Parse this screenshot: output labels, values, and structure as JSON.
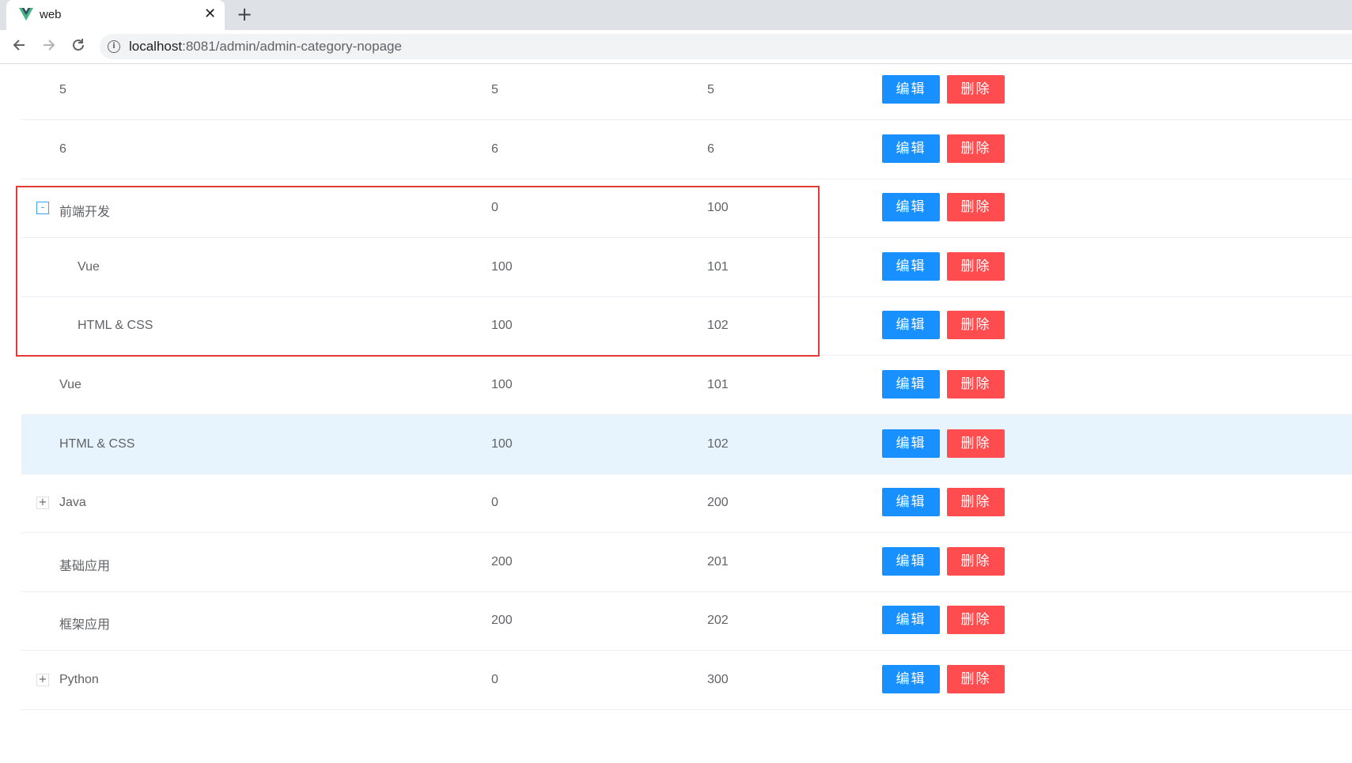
{
  "browser": {
    "tab_title": "web",
    "url_host": "localhost",
    "url_path": ":8081/admin/admin-category-nopage"
  },
  "table": {
    "edit_label": "编辑",
    "delete_label": "删除",
    "rows": [
      {
        "name": "5",
        "parent": "5",
        "sort": "5",
        "indent": false,
        "expand": ""
      },
      {
        "name": "6",
        "parent": "6",
        "sort": "6",
        "indent": false,
        "expand": ""
      },
      {
        "name": "前端开发",
        "parent": "0",
        "sort": "100",
        "indent": false,
        "expand": "-"
      },
      {
        "name": "Vue",
        "parent": "100",
        "sort": "101",
        "indent": true,
        "expand": ""
      },
      {
        "name": "HTML & CSS",
        "parent": "100",
        "sort": "102",
        "indent": true,
        "expand": ""
      },
      {
        "name": "Vue",
        "parent": "100",
        "sort": "101",
        "indent": false,
        "expand": ""
      },
      {
        "name": "HTML & CSS",
        "parent": "100",
        "sort": "102",
        "indent": false,
        "expand": "",
        "highlight": true
      },
      {
        "name": "Java",
        "parent": "0",
        "sort": "200",
        "indent": false,
        "expand": "+"
      },
      {
        "name": "基础应用",
        "parent": "200",
        "sort": "201",
        "indent": false,
        "expand": ""
      },
      {
        "name": "框架应用",
        "parent": "200",
        "sort": "202",
        "indent": false,
        "expand": ""
      },
      {
        "name": "Python",
        "parent": "0",
        "sort": "300",
        "indent": false,
        "expand": "+"
      }
    ]
  },
  "colors": {
    "edit": "#1890ff",
    "delete": "#ff4d4f",
    "highlight_row": "#e8f4fd",
    "annotation_box": "#e53935"
  }
}
